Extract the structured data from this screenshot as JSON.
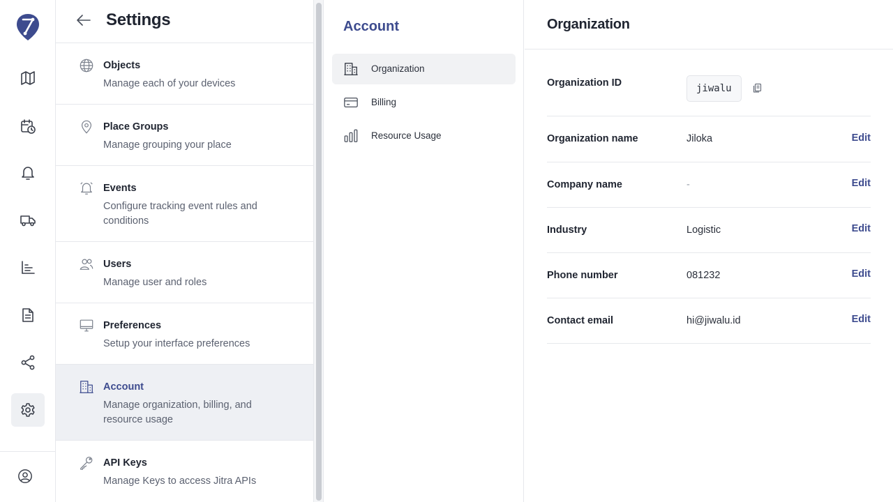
{
  "rail": {
    "icons": [
      "map-icon",
      "schedule-icon",
      "bell-icon",
      "truck-icon",
      "bar-chart-icon",
      "document-icon",
      "share-icon",
      "gear-icon"
    ],
    "active": "gear-icon",
    "user_icon": "user-circle-icon",
    "accent": "#3d4b8e"
  },
  "settings": {
    "title": "Settings",
    "items": [
      {
        "name": "Objects",
        "desc": "Manage each of your devices",
        "icon": "globe-icon"
      },
      {
        "name": "Place Groups",
        "desc": "Manage grouping your place",
        "icon": "map-pin-icon"
      },
      {
        "name": "Events",
        "desc": "Configure tracking event rules and conditions",
        "icon": "alarm-bell-icon"
      },
      {
        "name": "Users",
        "desc": "Manage user and roles",
        "icon": "users-icon"
      },
      {
        "name": "Preferences",
        "desc": "Setup your interface preferences",
        "icon": "monitor-icon"
      },
      {
        "name": "Account",
        "desc": "Manage organization, billing, and resource usage",
        "icon": "building-icon"
      },
      {
        "name": "API Keys",
        "desc": "Manage Keys to access Jitra APIs",
        "icon": "key-icon"
      }
    ],
    "active_item": "Account"
  },
  "account": {
    "title": "Account",
    "items": [
      {
        "label": "Organization",
        "icon": "building-icon"
      },
      {
        "label": "Billing",
        "icon": "credit-card-icon"
      },
      {
        "label": "Resource Usage",
        "icon": "bar-chart-icon"
      }
    ],
    "active_item": "Organization"
  },
  "org": {
    "title": "Organization",
    "id_label": "Organization ID",
    "id_value": "jiwalu",
    "edit_label": "Edit",
    "rows": [
      {
        "label": "Organization name",
        "value": "Jiloka"
      },
      {
        "label": "Company name",
        "value": "-"
      },
      {
        "label": "Industry",
        "value": "Logistic"
      },
      {
        "label": "Phone number",
        "value": "081232"
      },
      {
        "label": "Contact email",
        "value": "hi@jiwalu.id"
      }
    ]
  }
}
